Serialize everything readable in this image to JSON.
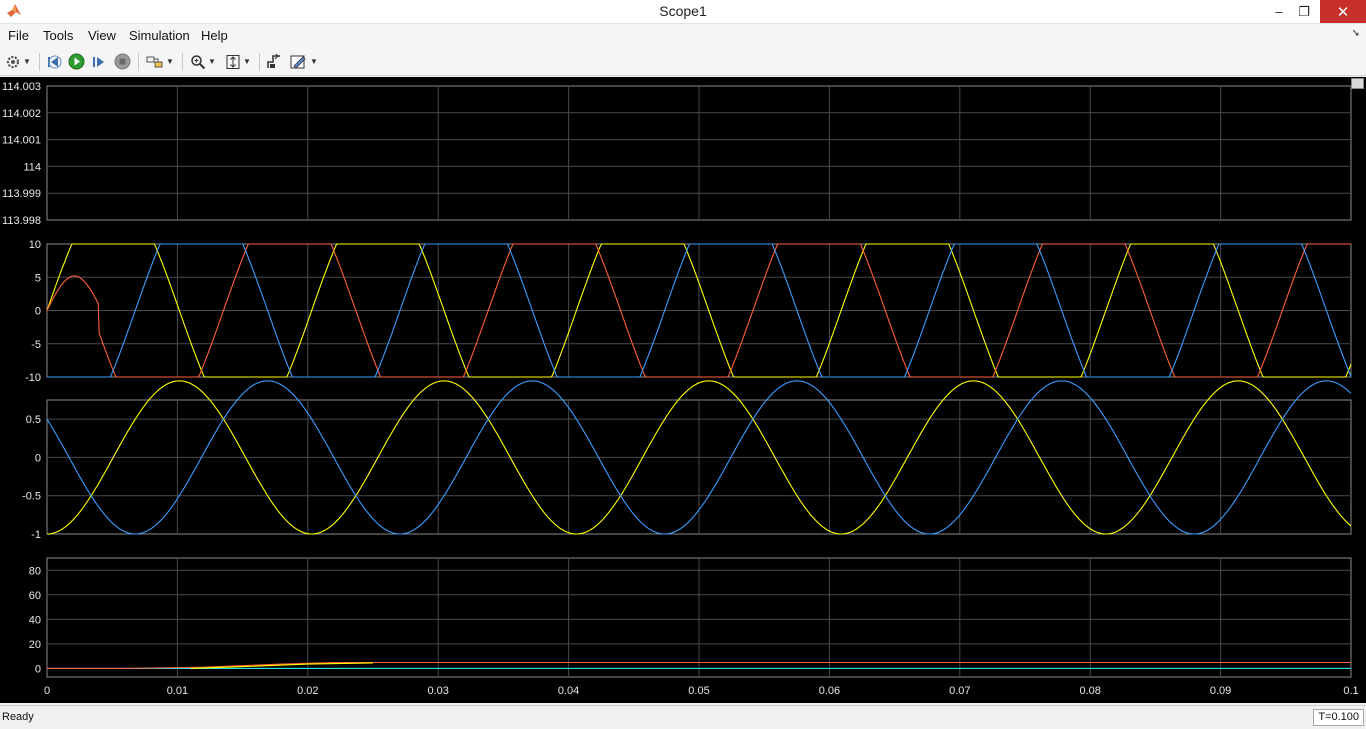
{
  "window": {
    "title": "Scope1",
    "minimize": "–",
    "restore": "❐",
    "close": "✕"
  },
  "menu": {
    "items": [
      "File",
      "Tools",
      "View",
      "Simulation",
      "Help"
    ]
  },
  "toolbar": {
    "icons": [
      "settings-icon",
      "step-back-icon",
      "run-icon",
      "step-forward-icon",
      "stop-icon",
      "highlight-block-icon",
      "zoom-icon",
      "autoscale-icon",
      "signal-selector-icon",
      "style-icon"
    ]
  },
  "colors": {
    "yellow": "#ffff00",
    "red": "#ff5f3a",
    "blue": "#3a9dff",
    "cyan": "#25e1e1",
    "grid": "#4a4a4a"
  },
  "chart_data": [
    {
      "type": "line",
      "yticks": [
        "114.003",
        "114.002",
        "114.001",
        "114",
        "113.999",
        "113.998"
      ],
      "ylim": [
        113.998,
        114.003
      ],
      "xlim": [
        0,
        0.1
      ],
      "series": []
    },
    {
      "type": "line",
      "yticks": [
        "10",
        "5",
        "0",
        "-5",
        "-10"
      ],
      "ylim": [
        -10,
        10
      ],
      "xlim": [
        0,
        0.1
      ],
      "series": [
        {
          "color": "yellow",
          "function": "clipped_sine",
          "amplitude": 18,
          "period": 0.0203,
          "phase_deg": 0
        },
        {
          "color": "red",
          "function": "clipped_sine",
          "amplitude": 18,
          "period": 0.0203,
          "phase_deg": 120
        },
        {
          "color": "blue",
          "function": "clipped_sine",
          "amplitude": 18,
          "period": 0.0203,
          "phase_deg": 240
        }
      ],
      "note_initial_red_peak": 5.2
    },
    {
      "type": "line",
      "yticks": [
        "0.5",
        "0",
        "-0.5",
        "-1"
      ],
      "ylim": [
        -1,
        0.75
      ],
      "xlim": [
        0,
        0.1
      ],
      "series": [
        {
          "color": "yellow",
          "function": "sine",
          "amplitude": 1,
          "period": 0.0203,
          "phase_deg": 0
        },
        {
          "color": "blue",
          "function": "sine",
          "amplitude": 1,
          "period": 0.0203,
          "phase_deg": 240
        }
      ]
    },
    {
      "type": "line",
      "yticks": [
        "80",
        "60",
        "40",
        "20",
        "0"
      ],
      "xticks": [
        "0",
        "0.01",
        "0.02",
        "0.03",
        "0.04",
        "0.05",
        "0.06",
        "0.07",
        "0.08",
        "0.09",
        "0.1"
      ],
      "ylim": [
        -7,
        90
      ],
      "xlim": [
        0,
        0.1
      ],
      "series": [
        {
          "color": "cyan",
          "x": [
            0,
            0.1
          ],
          "y": [
            0,
            0
          ]
        },
        {
          "color": "red",
          "x": [
            0,
            0.006,
            0.012,
            0.018,
            0.022,
            0.1
          ],
          "y": [
            0,
            0,
            1,
            3.5,
            4.8,
            4.8
          ]
        },
        {
          "color": "yellow",
          "x": [
            0.011,
            0.015,
            0.02,
            0.025
          ],
          "y": [
            0,
            1.5,
            3.5,
            4.5
          ]
        }
      ]
    }
  ],
  "status": {
    "text": "Ready",
    "time": "T=0.100"
  }
}
